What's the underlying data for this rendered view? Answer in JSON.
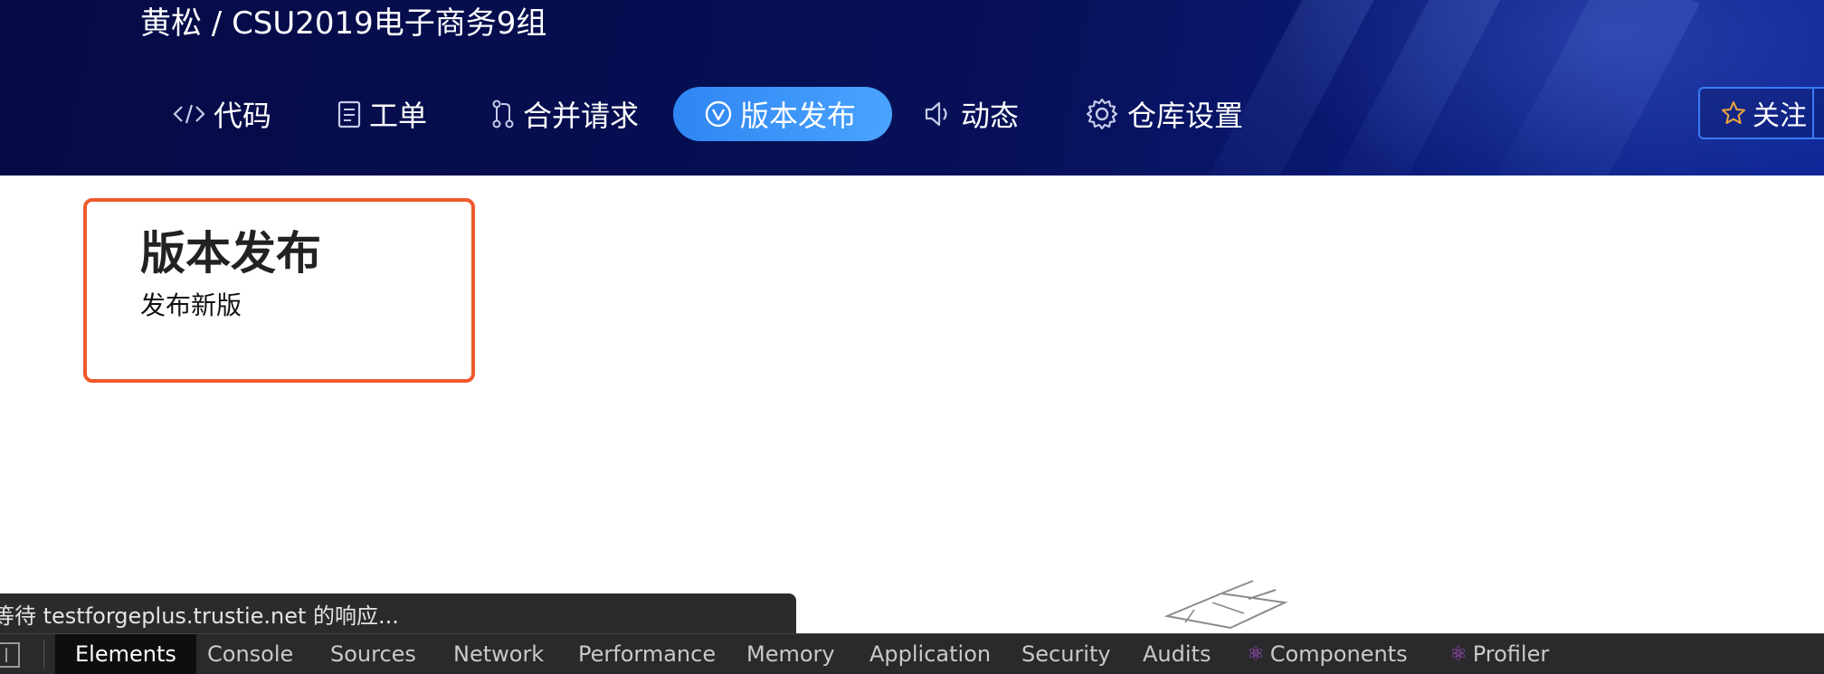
{
  "header": {
    "repo_title": "黄松 / CSU2019电子商务9组",
    "tabs": [
      {
        "label": "代码",
        "icon": "code-icon",
        "active": false
      },
      {
        "label": "工单",
        "icon": "clipboard-icon",
        "active": false
      },
      {
        "label": "合并请求",
        "icon": "merge-request-icon",
        "active": false
      },
      {
        "label": "版本发布",
        "icon": "version-check-icon",
        "active": true
      },
      {
        "label": "动态",
        "icon": "speaker-icon",
        "active": false
      },
      {
        "label": "仓库设置",
        "icon": "gear-icon",
        "active": false
      }
    ],
    "follow_label": "关注",
    "colors": {
      "active_tab": "#3694f8",
      "header_bg": "#061058",
      "follow_border": "#3b7cf0"
    }
  },
  "content": {
    "title": "版本发布",
    "new_release_label": "发布新版",
    "highlight_color": "#ee5a2c"
  },
  "status": {
    "text": "等待 testforgeplus.trustie.net 的响应..."
  },
  "devtools": {
    "tabs": [
      {
        "label": "Elements",
        "active": true
      },
      {
        "label": "Console"
      },
      {
        "label": "Sources"
      },
      {
        "label": "Network"
      },
      {
        "label": "Performance"
      },
      {
        "label": "Memory"
      },
      {
        "label": "Application"
      },
      {
        "label": "Security"
      },
      {
        "label": "Audits"
      },
      {
        "label": "Components",
        "icon": "react-icon"
      },
      {
        "label": "Profiler",
        "icon": "react-icon"
      }
    ]
  }
}
